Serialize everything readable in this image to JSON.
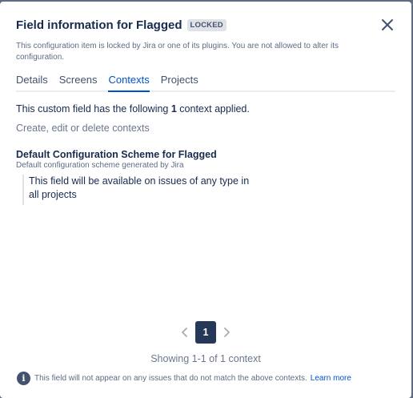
{
  "dialog": {
    "title": "Field information for Flagged",
    "badge": "LOCKED",
    "locked_message": "This configuration item is locked by Jira or one of its plugins. You are not allowed to alter its configuration.",
    "close_icon": "close-icon"
  },
  "tabs": [
    {
      "label": "Details",
      "active": false
    },
    {
      "label": "Screens",
      "active": false
    },
    {
      "label": "Contexts",
      "active": true
    },
    {
      "label": "Projects",
      "active": false
    }
  ],
  "contexts": {
    "summary_prefix": "This custom field has the following",
    "count": "1",
    "summary_suffix": "context applied.",
    "manage_link": "Create, edit or delete contexts",
    "scheme": {
      "name": "Default Configuration Scheme for Flagged",
      "description": "Default configuration scheme generated by Jira",
      "details": "This field will be available on issues of any type in all projects"
    }
  },
  "pagination": {
    "current_page": "1",
    "prev_icon": "chevron-left-icon",
    "next_icon": "chevron-right-icon",
    "showing": "Showing 1-1 of 1 context"
  },
  "footer": {
    "info_icon": "info-icon",
    "message": "This field will not appear on any issues that do not match the above contexts.",
    "link": "Learn more"
  },
  "colors": {
    "accent": "#0052cc",
    "text": "#172b4d",
    "subtle": "#5e6c84",
    "page_selected": "#253858"
  }
}
